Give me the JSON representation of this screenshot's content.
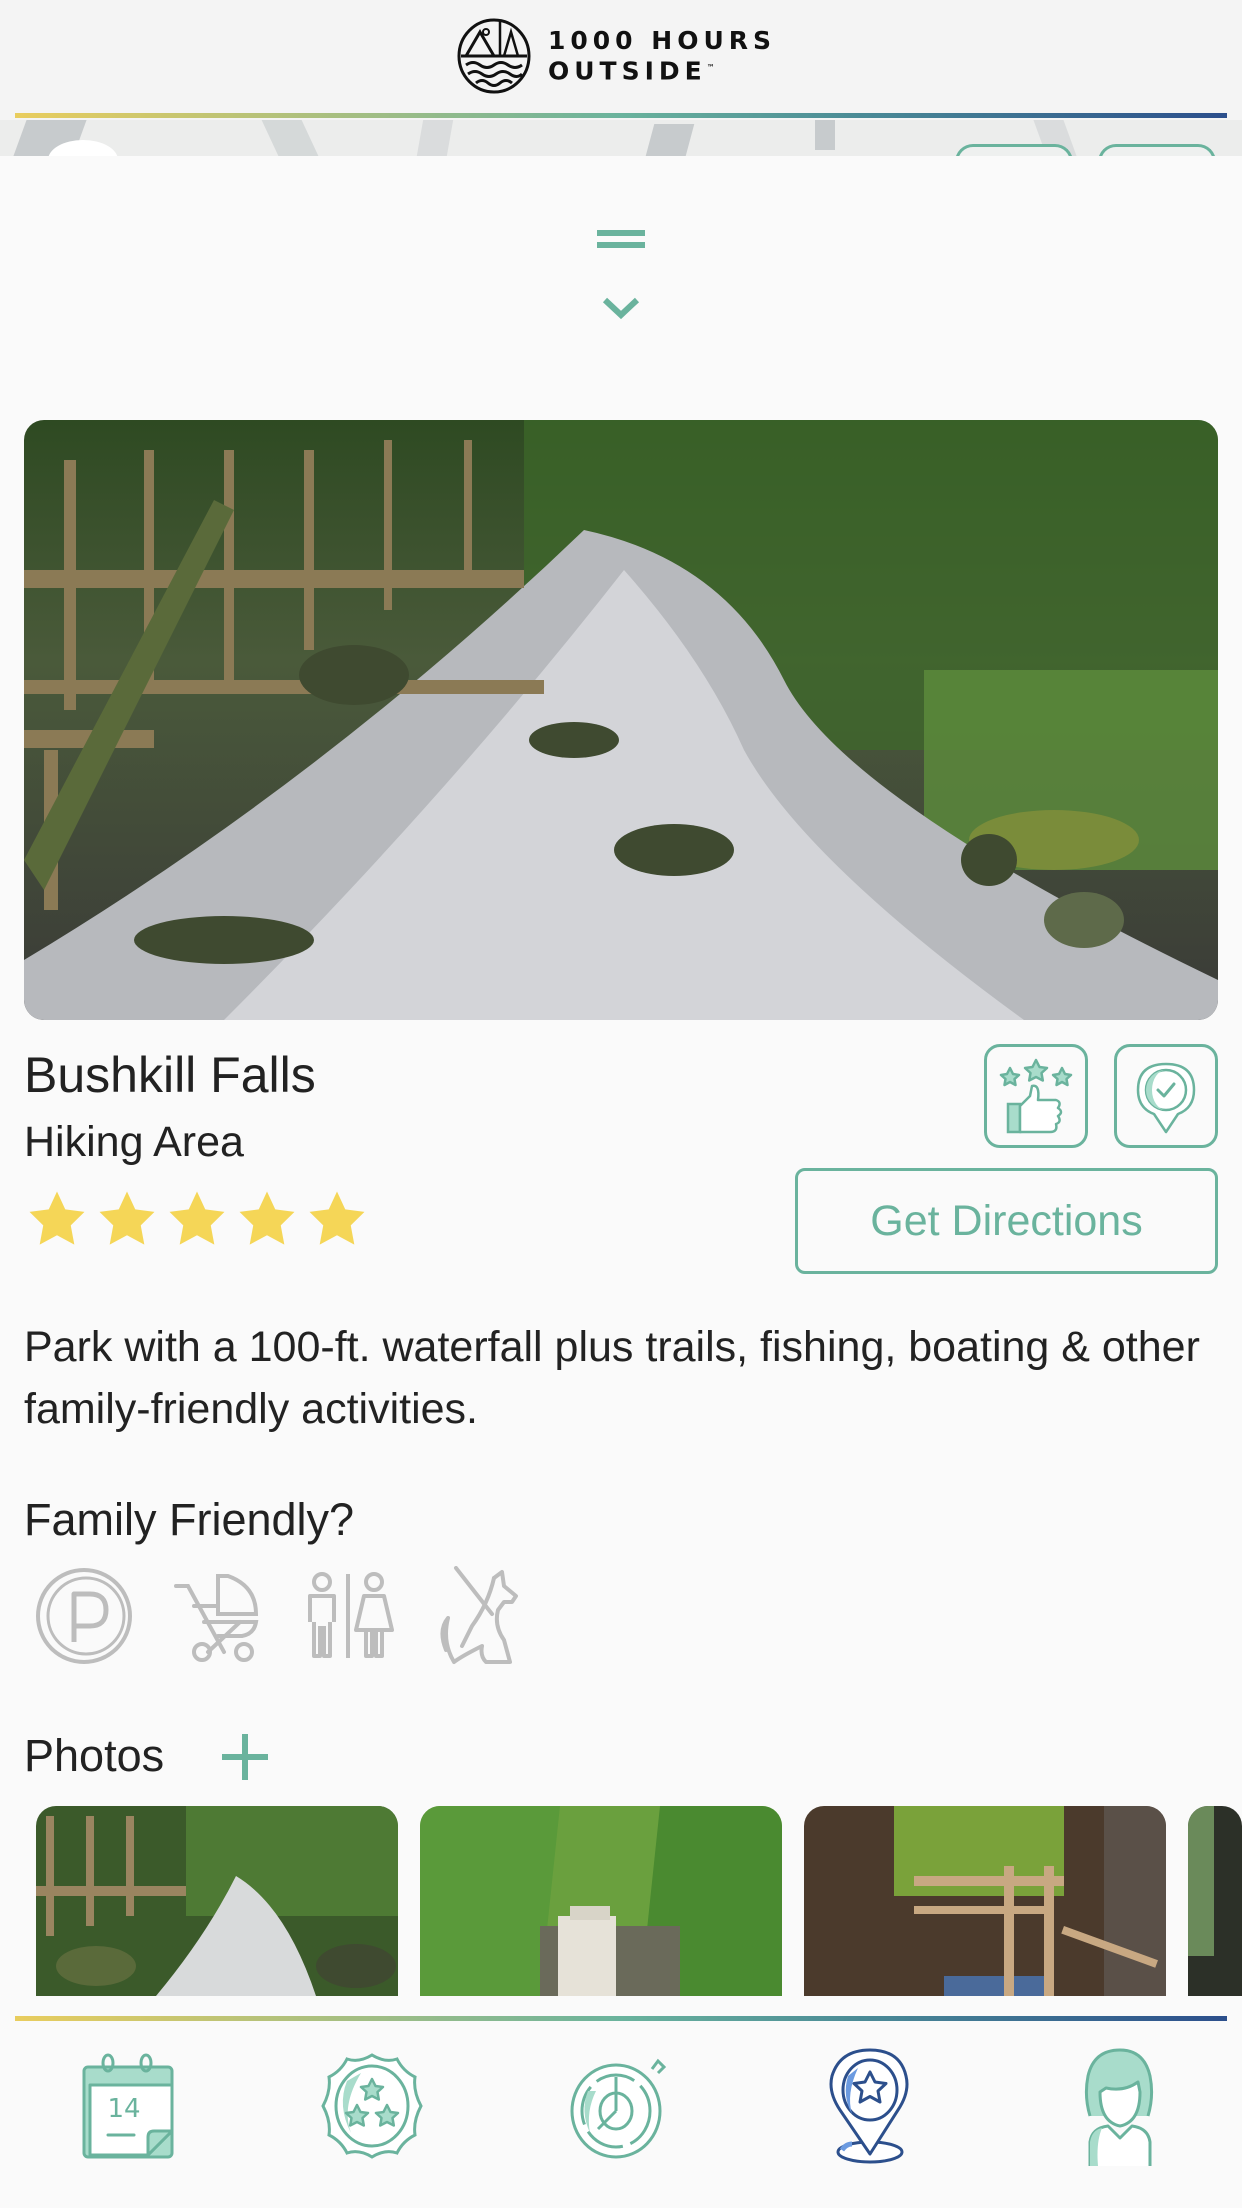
{
  "app": {
    "brand_line1": "1000 HOURS",
    "brand_line2": "OUTSIDE",
    "brand_tm": "™"
  },
  "place": {
    "name": "Bushkill Falls",
    "category": "Hiking Area",
    "rating": 5,
    "rating_max": 5,
    "description": "Park with a 100-ft. waterfall plus trails, fishing, boating & other family-friendly activities.",
    "directions_label": "Get Directions",
    "actions": [
      {
        "name": "rate-place-button",
        "icon": "thumbs-up-stars-icon"
      },
      {
        "name": "check-in-button",
        "icon": "location-check-icon"
      }
    ]
  },
  "family_friendly": {
    "label": "Family Friendly?",
    "amenities": [
      {
        "icon": "parking-icon",
        "label": "Parking"
      },
      {
        "icon": "stroller-icon",
        "label": "Stroller friendly"
      },
      {
        "icon": "restroom-icon",
        "label": "Restrooms"
      },
      {
        "icon": "dog-icon",
        "label": "Dog friendly"
      }
    ]
  },
  "photos": {
    "label": "Photos",
    "add_icon": "plus-icon",
    "items": [
      {
        "alt": "Creek beside wooden boardwalk"
      },
      {
        "alt": "Waterfall in green gorge"
      },
      {
        "alt": "Wooden stairs over waterfall"
      },
      {
        "alt": "Partial photo"
      }
    ]
  },
  "tabbar": {
    "items": [
      {
        "icon": "calendar-icon",
        "badge_text": "14",
        "active": false
      },
      {
        "icon": "badge-stars-icon",
        "active": false
      },
      {
        "icon": "stopwatch-icon",
        "active": false
      },
      {
        "icon": "location-star-icon",
        "active": true
      },
      {
        "icon": "profile-icon",
        "active": false
      }
    ]
  },
  "colors": {
    "accent": "#6ab39d",
    "active_tab": "#2c4f8c",
    "star": "#f5d657",
    "amenity_inactive": "#bdbdbd"
  }
}
